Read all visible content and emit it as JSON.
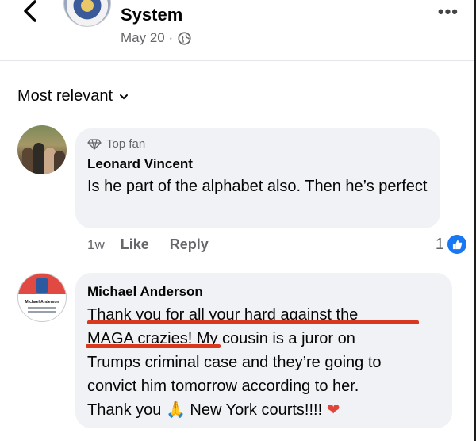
{
  "header": {
    "page_name": "System",
    "post_date": "May 20 ·",
    "more_label": "•••"
  },
  "sort": {
    "label": "Most relevant"
  },
  "comments": [
    {
      "badge": "Top fan",
      "author": "Leonard Vincent",
      "text": "Is he part of the alphabet also. Then he’s perfect",
      "time": "1w",
      "like": "Like",
      "reply": "Reply",
      "reaction_count": "1"
    },
    {
      "author": "Michael Anderson",
      "avatar_text": "Michael Anderson",
      "text_lines": [
        "Thank you for all your hard against the",
        "MAGA crazies! My cousin is a juror on",
        "Trumps criminal case and they’re going to",
        "convict him tomorrow according to her."
      ],
      "last_line_start": "Thank you",
      "last_line_end": "New York courts!!!!",
      "emoji_pray": "🙏",
      "emoji_heart": "❤"
    }
  ],
  "colors": {
    "accent": "#1877f2",
    "underline": "#d9381e",
    "bubble": "#f0f2f5",
    "muted_text": "#65676b"
  }
}
